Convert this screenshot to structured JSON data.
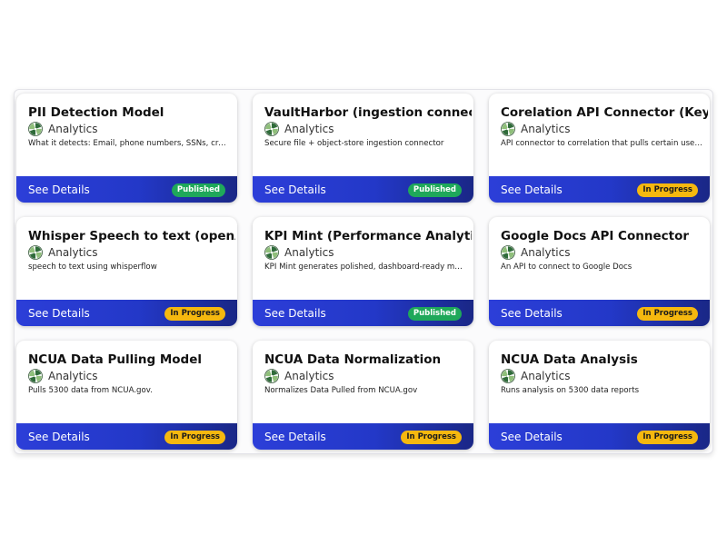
{
  "details_label": "See Details",
  "colors": {
    "footer_gradient_start": "#2c3ed8",
    "footer_gradient_end": "#1a2786",
    "published_badge": "#1fa85a",
    "in_progress_badge": "#f5b80f"
  },
  "cards": [
    {
      "title": "PII Detection Model",
      "category": "Analytics",
      "category_icon": "analytics-pinwheel-icon",
      "description": "What it detects: Email, phone numbers, SSNs, credit cards...",
      "status": "Published"
    },
    {
      "title": "VaultHarbor (ingestion connector)",
      "category": "Analytics",
      "category_icon": "analytics-pinwheel-icon",
      "description": "Secure file + object-store ingestion connector",
      "status": "Published"
    },
    {
      "title": "Corelation API Connector (KeyBridge)",
      "category": "Analytics",
      "category_icon": "analytics-pinwheel-icon",
      "description": "API connector to correlation that pulls certain user data",
      "status": "In Progress"
    },
    {
      "title": "Whisper Speech to text (openAI API)",
      "category": "Analytics",
      "category_icon": "analytics-pinwheel-icon",
      "description": "speech to text using whisperflow",
      "status": "In Progress"
    },
    {
      "title": "KPI Mint (Performance Analytics)",
      "category": "Analytics",
      "category_icon": "analytics-pinwheel-icon",
      "description": "KPI Mint generates polished, dashboard-ready metrics",
      "status": "Published"
    },
    {
      "title": "Google Docs API Connector",
      "category": "Analytics",
      "category_icon": "analytics-pinwheel-icon",
      "description": "An API to connect to Google Docs",
      "status": "In Progress"
    },
    {
      "title": "NCUA Data Pulling Model",
      "category": "Analytics",
      "category_icon": "analytics-pinwheel-icon",
      "description": "Pulls 5300 data from NCUA.gov.",
      "status": "In Progress"
    },
    {
      "title": "NCUA Data Normalization",
      "category": "Analytics",
      "category_icon": "analytics-pinwheel-icon",
      "description": "Normalizes Data Pulled from NCUA.gov",
      "status": "In Progress"
    },
    {
      "title": "NCUA Data Analysis",
      "category": "Analytics",
      "category_icon": "analytics-pinwheel-icon",
      "description": "Runs analysis on 5300 data reports",
      "status": "In Progress"
    }
  ]
}
